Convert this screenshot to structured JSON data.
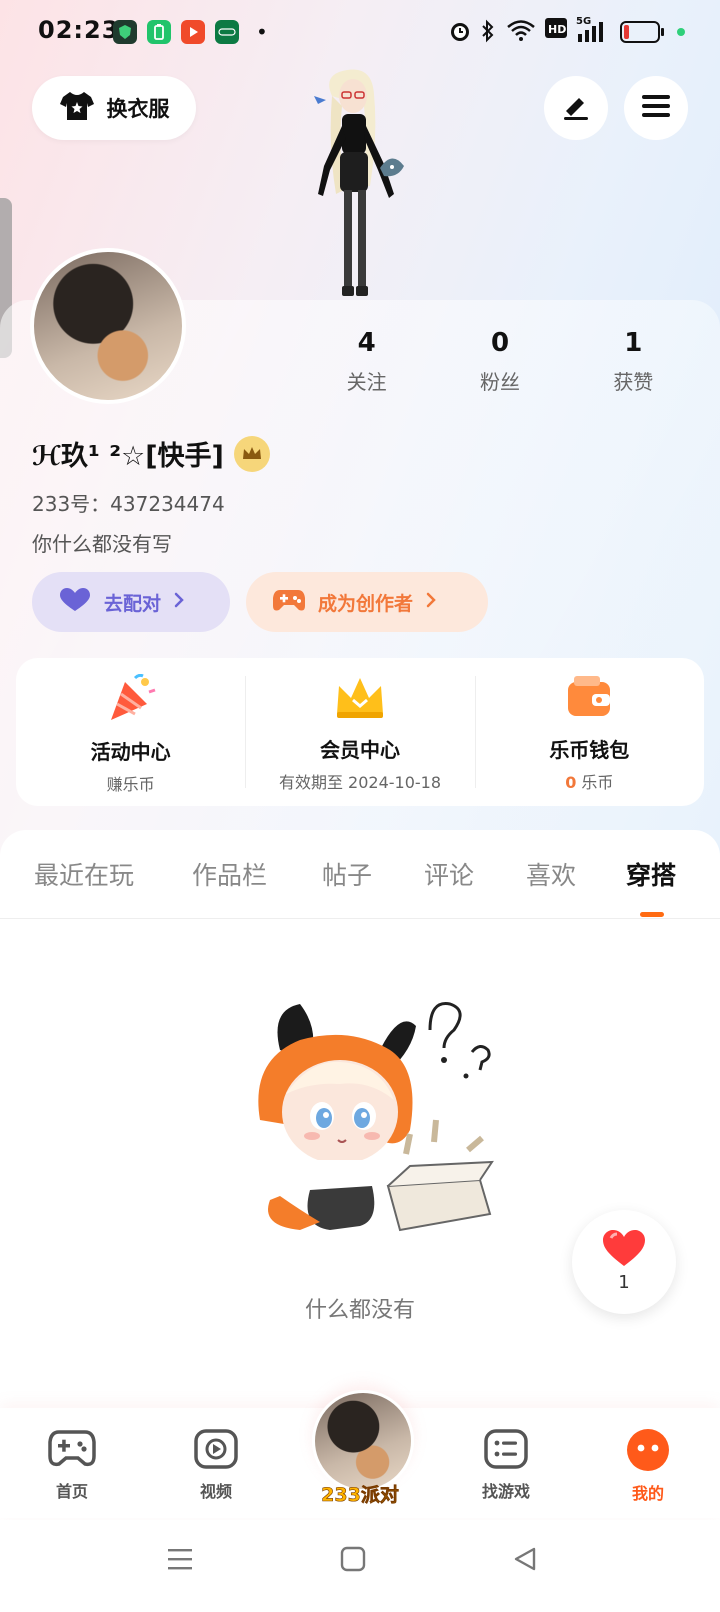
{
  "status_bar": {
    "time": "02:23",
    "dot": "•",
    "battery_color": "#e53935"
  },
  "header": {
    "outfit_button_label": "换衣服",
    "edit_icon": "pen-icon",
    "menu_icon": "menu-icon"
  },
  "profile": {
    "stats": [
      {
        "value": "4",
        "label": "关注"
      },
      {
        "value": "0",
        "label": "粉丝"
      },
      {
        "value": "1",
        "label": "获赞"
      }
    ],
    "username": "ℋ玖¹ ²☆[快手]",
    "uid": "233号：437234474",
    "bio": "你什么都没有写",
    "chips": {
      "pair": "去配对",
      "creator": "成为创作者"
    }
  },
  "quick_entries": [
    {
      "title": "活动中心",
      "sub": "赚乐币"
    },
    {
      "title": "会员中心",
      "sub": "有效期至 2024-10-18"
    },
    {
      "title": "乐币钱包",
      "sub_value": "0",
      "sub_unit": "乐币"
    }
  ],
  "tabs": [
    "最近在玩",
    "作品栏",
    "帖子",
    "评论",
    "喜欢",
    "穿搭"
  ],
  "active_tab": "穿搭",
  "empty_state": "什么都没有",
  "like_float": {
    "count": "1"
  },
  "bottom_nav": {
    "home": "首页",
    "video": "视频",
    "party": "233派对",
    "find_game": "找游戏",
    "mine": "我的"
  },
  "colors": {
    "accent": "#ff6b12",
    "pair_purple": "#6a63d6",
    "creator_orange": "#f2783a"
  }
}
